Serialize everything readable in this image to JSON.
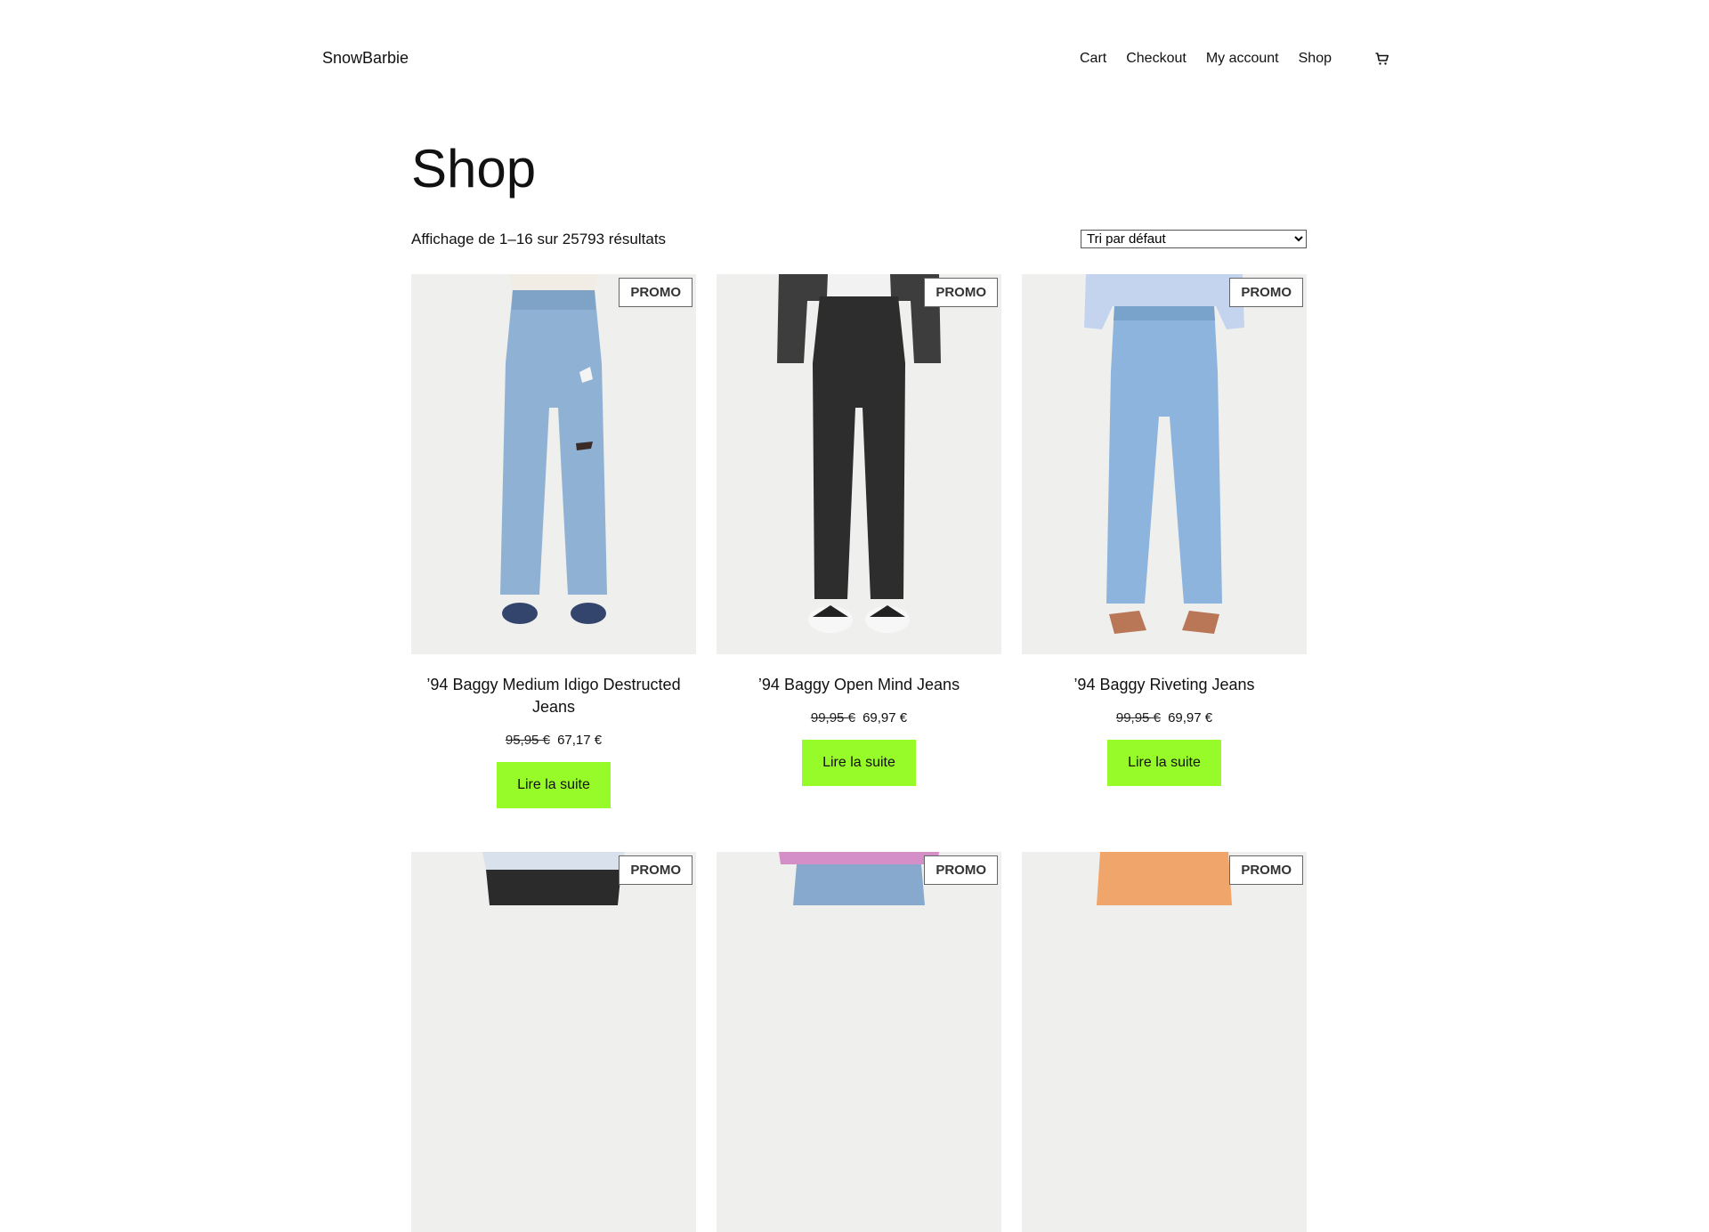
{
  "site": {
    "title": "SnowBarbie"
  },
  "nav": {
    "items": [
      {
        "label": "Cart"
      },
      {
        "label": "Checkout"
      },
      {
        "label": "My account"
      },
      {
        "label": "Shop"
      }
    ]
  },
  "page": {
    "title": "Shop",
    "result_count": "Affichage de 1–16 sur 25793 résultats",
    "ordering": "Tri par défaut"
  },
  "products": [
    {
      "badge": "PROMO",
      "title": "’94 Baggy Medium Idigo Destructed Jeans",
      "regular_price": "95,95 €",
      "sale_price": "67,17 €",
      "button": "Lire la suite",
      "colors": {
        "top": "#f1ece4",
        "jeans": "#8fb2d4",
        "shoes": "#34456d"
      }
    },
    {
      "badge": "PROMO",
      "title": "’94 Baggy Open Mind Jeans",
      "regular_price": "99,95 €",
      "sale_price": "69,97 €",
      "button": "Lire la suite",
      "colors": {
        "top": "#3d3d3d",
        "jeans": "#2d2d2d",
        "shoes": "#f7f7f7"
      }
    },
    {
      "badge": "PROMO",
      "title": "’94 Baggy Riveting Jeans",
      "regular_price": "99,95 €",
      "sale_price": "69,97 €",
      "button": "Lire la suite",
      "colors": {
        "top": "#c4d4ef",
        "jeans": "#8cb4dc",
        "shoes": "#ba7758"
      }
    },
    {
      "badge": "PROMO",
      "colors": {
        "top": "#d8e1ec",
        "jeans": "#2b2b2b",
        "shoes": "#2b2b2b"
      }
    },
    {
      "badge": "PROMO",
      "colors": {
        "top": "#d48fc8",
        "jeans": "#86a9cd",
        "shoes": "#86a9cd"
      }
    },
    {
      "badge": "PROMO",
      "colors": {
        "top": "#f0a66b",
        "jeans": "#e9c8aa",
        "shoes": "#e9c8aa"
      }
    }
  ]
}
